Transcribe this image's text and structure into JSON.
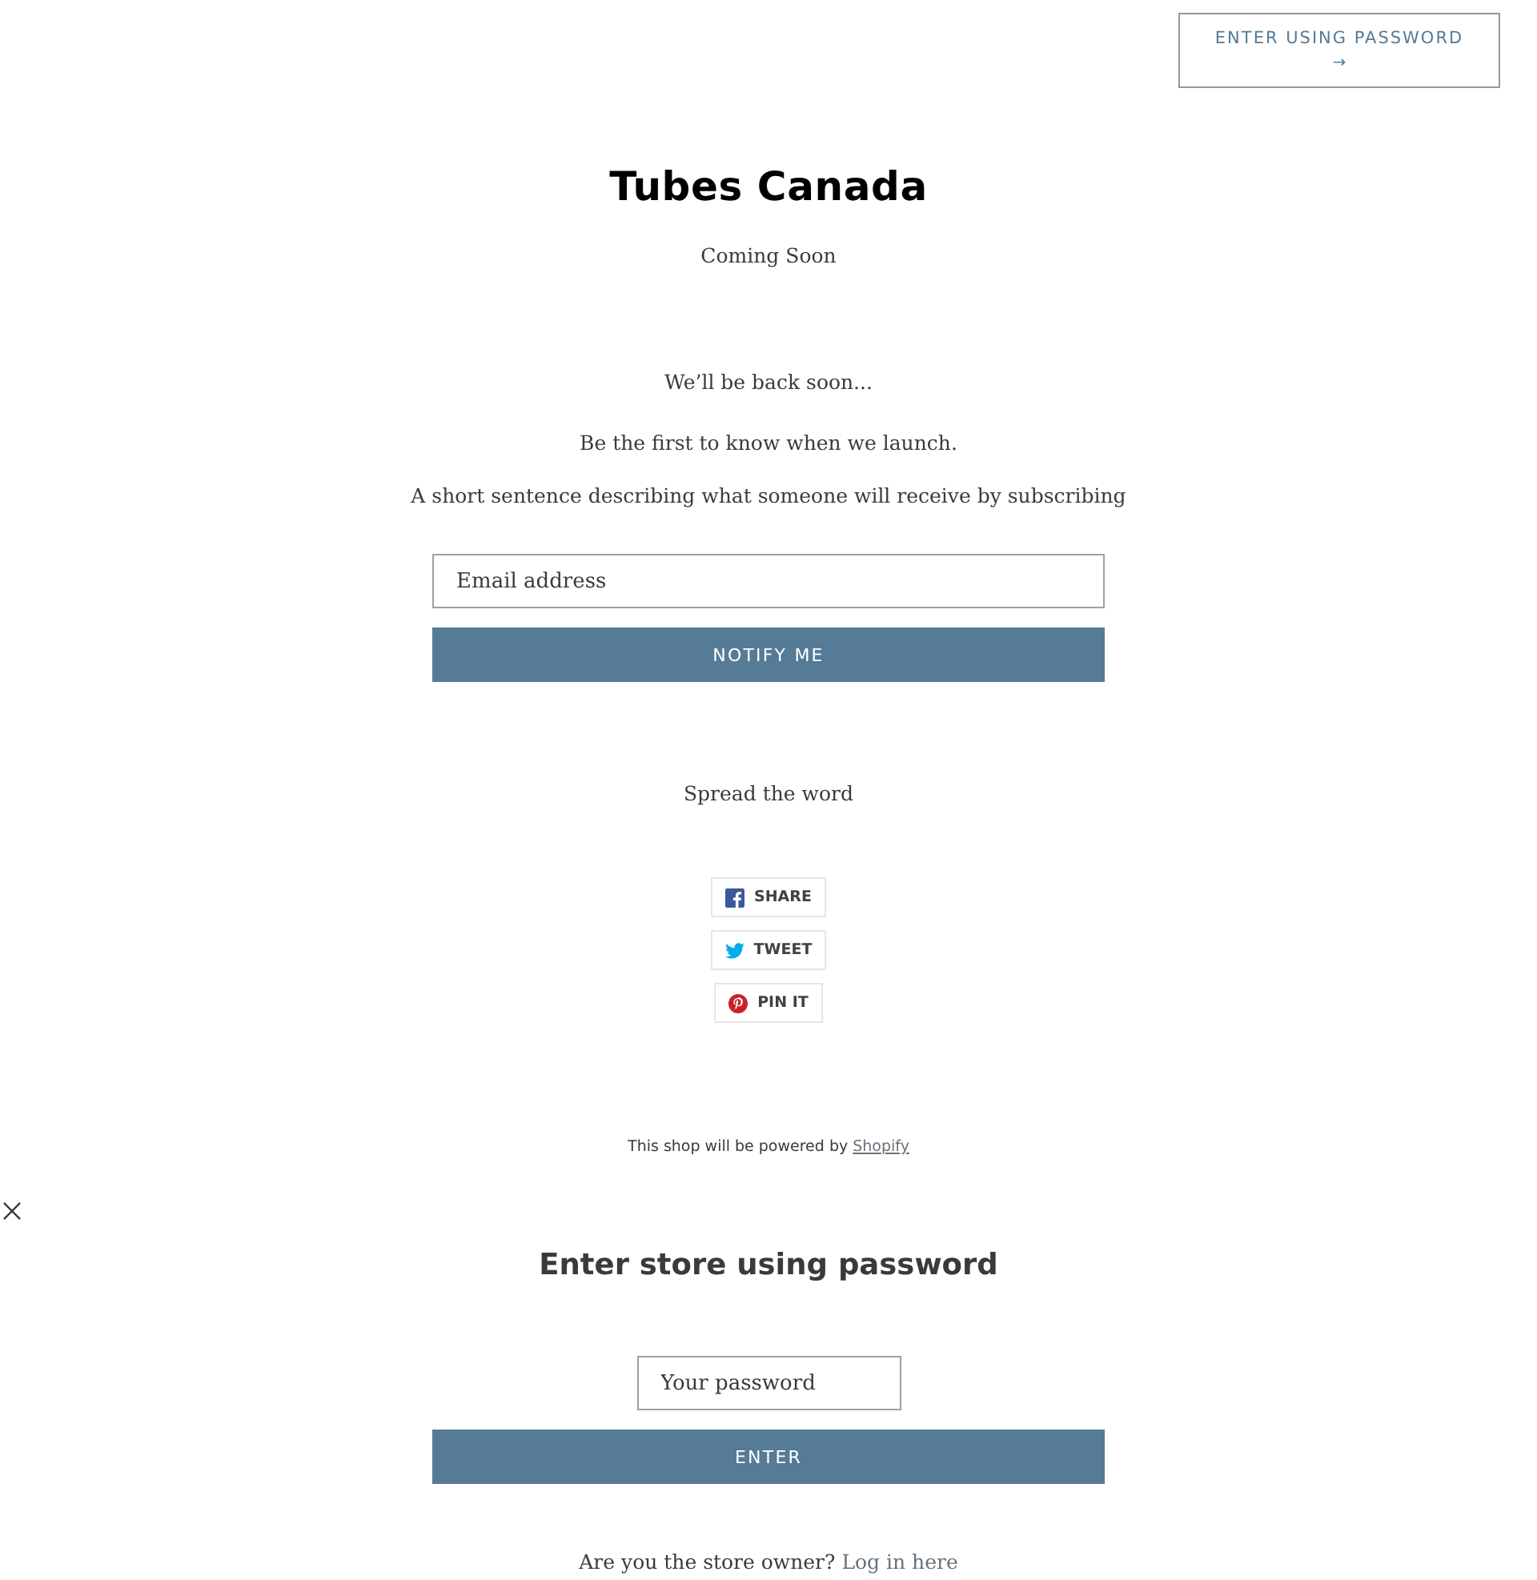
{
  "header": {
    "password_button": {
      "label": "ENTER USING PASSWORD",
      "arrow": "→"
    }
  },
  "store": {
    "title": "Tubes Canada",
    "tagline": "Coming Soon"
  },
  "newsletter": {
    "heading": "We’ll be back soon...",
    "subheading": "Be the first to know when we launch.",
    "description": "A short sentence describing what someone will receive by subscribing",
    "email": {
      "placeholder": "Email address"
    },
    "button": "NOTIFY ME"
  },
  "share": {
    "heading": "Spread the word",
    "buttons": [
      {
        "kind": "facebook",
        "label": "SHARE"
      },
      {
        "kind": "twitter",
        "label": "TWEET"
      },
      {
        "kind": "pinterest",
        "label": "PIN IT"
      }
    ]
  },
  "footer": {
    "text": "This shop will be powered by",
    "link": "Shopify"
  },
  "password_modal": {
    "title": "Enter store using password",
    "password": {
      "placeholder": "Your password"
    },
    "button": "ENTER",
    "owner_text": "Are you the store owner?",
    "owner_link": "Log in here"
  }
}
